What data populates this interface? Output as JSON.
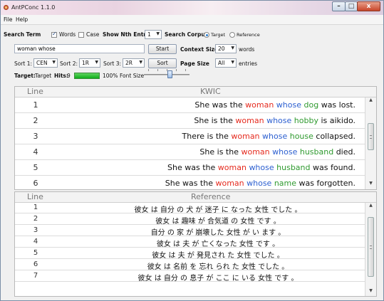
{
  "window": {
    "title": "AntPConc 1.1.0",
    "controls": {
      "minimize": "–",
      "maximize": "□",
      "close": "x"
    }
  },
  "menu": {
    "file": "File",
    "help": "Help"
  },
  "search": {
    "term_label": "Search Term",
    "words_label": "Words",
    "words_checked": true,
    "case_label": "Case",
    "case_checked": false,
    "nth_entry_label": "Show Nth Entry",
    "nth_entry_value": "1",
    "corpus_label": "Search Corpus",
    "target_label": "Target",
    "reference_label": "Reference",
    "selected_corpus": "Target",
    "input_value": "woman whose",
    "start_label": "Start",
    "context_size_label": "Context Size",
    "context_size_value": "20",
    "words_unit": "words"
  },
  "sort": {
    "sort1_label": "Sort 1:",
    "sort1_value": "CEN",
    "sort2_label": "Sort 2:",
    "sort2_value": "1R",
    "sort3_label": "Sort 3:",
    "sort3_value": "2R",
    "sort_button": "Sort",
    "page_size_label": "Page Size",
    "page_size_value": "All",
    "entries_label": "entries"
  },
  "status": {
    "target_label": "Target:",
    "target_name": "Target",
    "hits_label": "Hits:",
    "hits_value": "9",
    "hits_percent": "100%",
    "hits_fill": 1.0,
    "font_size_label": "Font Size",
    "font_size_level": 0.5
  },
  "kwic_panel": {
    "line_header": "Line",
    "kwic_header": "KWIC",
    "rows": [
      {
        "line": "1",
        "pre": "She was the ",
        "kw1": "woman",
        "kw2": "whose",
        "next": "dog",
        "post": " was lost."
      },
      {
        "line": "2",
        "pre": "She is the ",
        "kw1": "woman",
        "kw2": "whose",
        "next": "hobby",
        "post": " is aikido."
      },
      {
        "line": "3",
        "pre": "There is the ",
        "kw1": "woman",
        "kw2": "whose",
        "next": "house",
        "post": " collapsed."
      },
      {
        "line": "4",
        "pre": "She is the ",
        "kw1": "woman",
        "kw2": "whose",
        "next": "husband",
        "post": " died."
      },
      {
        "line": "5",
        "pre": "She was the ",
        "kw1": "woman",
        "kw2": "whose",
        "next": "husband",
        "post": " was found."
      },
      {
        "line": "6",
        "pre": "She was the ",
        "kw1": "woman",
        "kw2": "whose",
        "next": "name",
        "post": " was forgotten."
      }
    ]
  },
  "reference_panel": {
    "line_header": "Line",
    "reference_header": "Reference",
    "rows": [
      {
        "line": "1",
        "text": "彼女 は 自分 の 犬 が 迷子 に なった 女性 でした 。"
      },
      {
        "line": "2",
        "text": "彼女 は 趣味 が 合気道 の 女性 です 。"
      },
      {
        "line": "3",
        "text": "自分 の 家 が 崩壊した 女性 が い ます 。"
      },
      {
        "line": "4",
        "text": "彼女 は 夫 が 亡くなった 女性 です 。"
      },
      {
        "line": "5",
        "text": "彼女 は 夫 が 発見され た 女性 でした 。"
      },
      {
        "line": "6",
        "text": "彼女 は 名前 を 忘れ られ た 女性 でした 。"
      },
      {
        "line": "7",
        "text": "彼女 は 自分 の 息子 が ここ に いる 女性 です 。"
      }
    ]
  },
  "colors": {
    "keyword": "#e52a1e",
    "whose": "#2c5fd0",
    "next_word": "#2f9a2f",
    "hit_bar": "#0fae1b"
  }
}
